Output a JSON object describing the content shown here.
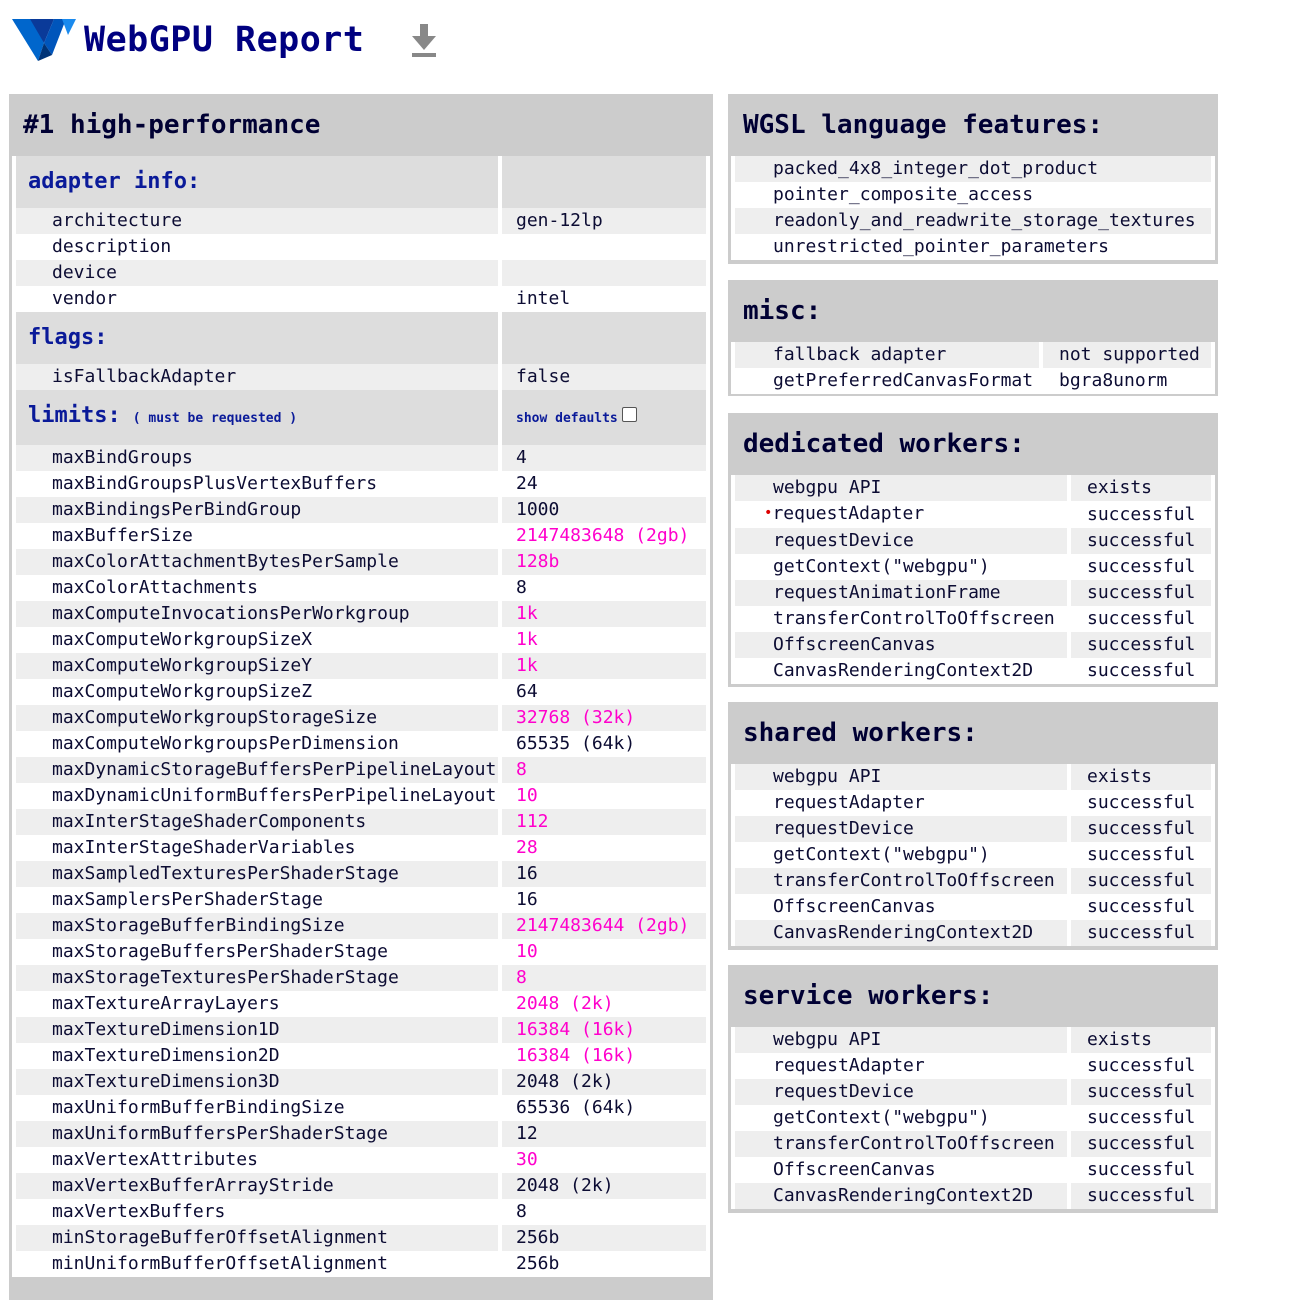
{
  "header": {
    "title": "WebGPU Report"
  },
  "adapter_panel": {
    "title": "#1 high-performance",
    "adapter_info_label": "adapter info:",
    "adapter_info": [
      {
        "k": "architecture",
        "v": "gen-12lp"
      },
      {
        "k": "description",
        "v": ""
      },
      {
        "k": "device",
        "v": ""
      },
      {
        "k": "vendor",
        "v": "intel"
      }
    ],
    "flags_label": "flags:",
    "flags": [
      {
        "k": "isFallbackAdapter",
        "v": "false"
      }
    ],
    "limits_label": "limits:",
    "limits_note": "( must be requested )",
    "show_defaults_label": "show defaults",
    "limits": [
      {
        "k": "maxBindGroups",
        "v": "4",
        "hl": false
      },
      {
        "k": "maxBindGroupsPlusVertexBuffers",
        "v": "24",
        "hl": false
      },
      {
        "k": "maxBindingsPerBindGroup",
        "v": "1000",
        "hl": false
      },
      {
        "k": "maxBufferSize",
        "v": "2147483648 (2gb)",
        "hl": true
      },
      {
        "k": "maxColorAttachmentBytesPerSample",
        "v": "128b",
        "hl": true
      },
      {
        "k": "maxColorAttachments",
        "v": "8",
        "hl": false
      },
      {
        "k": "maxComputeInvocationsPerWorkgroup",
        "v": "1k",
        "hl": true
      },
      {
        "k": "maxComputeWorkgroupSizeX",
        "v": "1k",
        "hl": true
      },
      {
        "k": "maxComputeWorkgroupSizeY",
        "v": "1k",
        "hl": true
      },
      {
        "k": "maxComputeWorkgroupSizeZ",
        "v": "64",
        "hl": false
      },
      {
        "k": "maxComputeWorkgroupStorageSize",
        "v": "32768 (32k)",
        "hl": true
      },
      {
        "k": "maxComputeWorkgroupsPerDimension",
        "v": "65535 (64k)",
        "hl": false
      },
      {
        "k": "maxDynamicStorageBuffersPerPipelineLayout",
        "v": "8",
        "hl": true
      },
      {
        "k": "maxDynamicUniformBuffersPerPipelineLayout",
        "v": "10",
        "hl": true
      },
      {
        "k": "maxInterStageShaderComponents",
        "v": "112",
        "hl": true
      },
      {
        "k": "maxInterStageShaderVariables",
        "v": "28",
        "hl": true
      },
      {
        "k": "maxSampledTexturesPerShaderStage",
        "v": "16",
        "hl": false
      },
      {
        "k": "maxSamplersPerShaderStage",
        "v": "16",
        "hl": false
      },
      {
        "k": "maxStorageBufferBindingSize",
        "v": "2147483644 (2gb)",
        "hl": true
      },
      {
        "k": "maxStorageBuffersPerShaderStage",
        "v": "10",
        "hl": true
      },
      {
        "k": "maxStorageTexturesPerShaderStage",
        "v": "8",
        "hl": true
      },
      {
        "k": "maxTextureArrayLayers",
        "v": "2048 (2k)",
        "hl": true
      },
      {
        "k": "maxTextureDimension1D",
        "v": "16384 (16k)",
        "hl": true
      },
      {
        "k": "maxTextureDimension2D",
        "v": "16384 (16k)",
        "hl": true
      },
      {
        "k": "maxTextureDimension3D",
        "v": "2048 (2k)",
        "hl": false
      },
      {
        "k": "maxUniformBufferBindingSize",
        "v": "65536 (64k)",
        "hl": false
      },
      {
        "k": "maxUniformBuffersPerShaderStage",
        "v": "12",
        "hl": false
      },
      {
        "k": "maxVertexAttributes",
        "v": "30",
        "hl": true
      },
      {
        "k": "maxVertexBufferArrayStride",
        "v": "2048 (2k)",
        "hl": false
      },
      {
        "k": "maxVertexBuffers",
        "v": "8",
        "hl": false
      },
      {
        "k": "minStorageBufferOffsetAlignment",
        "v": "256b",
        "hl": false
      },
      {
        "k": "minUniformBufferOffsetAlignment",
        "v": "256b",
        "hl": false
      }
    ]
  },
  "wgsl": {
    "title": "WGSL language features:",
    "items": [
      "packed_4x8_integer_dot_product",
      "pointer_composite_access",
      "readonly_and_readwrite_storage_textures",
      "unrestricted_pointer_parameters"
    ]
  },
  "misc": {
    "title": "misc:",
    "rows": [
      {
        "k": "fallback adapter",
        "v": "not supported"
      },
      {
        "k": "getPreferredCanvasFormat",
        "v": "bgra8unorm"
      }
    ]
  },
  "dedicated": {
    "title": "dedicated workers:",
    "rows": [
      {
        "k": "webgpu API",
        "v": "exists"
      },
      {
        "k": "requestAdapter",
        "v": "successful",
        "dot": true
      },
      {
        "k": "requestDevice",
        "v": "successful"
      },
      {
        "k": "getContext(\"webgpu\")",
        "v": "successful"
      },
      {
        "k": "requestAnimationFrame",
        "v": "successful"
      },
      {
        "k": "transferControlToOffscreen",
        "v": "successful"
      },
      {
        "k": "OffscreenCanvas",
        "v": "successful"
      },
      {
        "k": "CanvasRenderingContext2D",
        "v": "successful"
      }
    ]
  },
  "shared": {
    "title": "shared workers:",
    "rows": [
      {
        "k": "webgpu API",
        "v": "exists"
      },
      {
        "k": "requestAdapter",
        "v": "successful"
      },
      {
        "k": "requestDevice",
        "v": "successful"
      },
      {
        "k": "getContext(\"webgpu\")",
        "v": "successful"
      },
      {
        "k": "transferControlToOffscreen",
        "v": "successful"
      },
      {
        "k": "OffscreenCanvas",
        "v": "successful"
      },
      {
        "k": "CanvasRenderingContext2D",
        "v": "successful"
      }
    ]
  },
  "service": {
    "title": "service workers:",
    "rows": [
      {
        "k": "webgpu API",
        "v": "exists"
      },
      {
        "k": "requestAdapter",
        "v": "successful"
      },
      {
        "k": "requestDevice",
        "v": "successful"
      },
      {
        "k": "getContext(\"webgpu\")",
        "v": "successful"
      },
      {
        "k": "transferControlToOffscreen",
        "v": "successful"
      },
      {
        "k": "OffscreenCanvas",
        "v": "successful"
      },
      {
        "k": "CanvasRenderingContext2D",
        "v": "successful"
      }
    ]
  },
  "colors": {
    "title": "#000080",
    "highlight": "#ff00cc",
    "panel": "#cccccc",
    "section": "#0a1a99"
  }
}
